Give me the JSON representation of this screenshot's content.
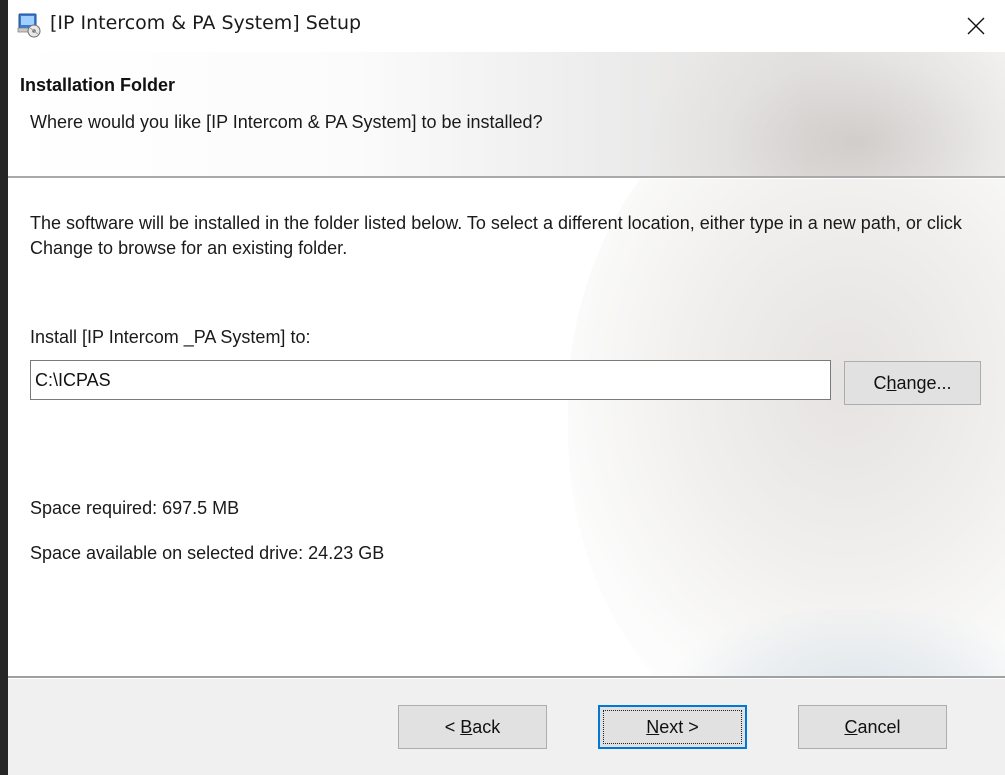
{
  "window": {
    "title": "[IP Intercom & PA System] Setup"
  },
  "header": {
    "title": "Installation Folder",
    "subtitle": "Where would you like [IP Intercom & PA System] to be installed?"
  },
  "content": {
    "description": "The software will be installed in the folder listed below. To select a different location, either type in a new path, or click Change to browse for an existing folder.",
    "install_label": "Install [IP Intercom _PA System] to:",
    "install_path": "C:\\ICPAS",
    "change_button": {
      "before": "C",
      "underline": "h",
      "after": "ange..."
    },
    "space_required": "Space required: 697.5 MB",
    "space_available": "Space available on selected drive: 24.23 GB"
  },
  "footer": {
    "back_button": {
      "before": "< ",
      "underline": "B",
      "after": "ack"
    },
    "next_button": {
      "before": "",
      "underline": "N",
      "after": "ext >"
    },
    "cancel_button": {
      "before": "",
      "underline": "C",
      "after": "ancel"
    }
  },
  "icons": {
    "app_icon": "installer-icon",
    "close_icon": "close-icon"
  },
  "colors": {
    "focus_border": "#0078d7",
    "button_face": "#e1e1e1",
    "footer_bg": "#f0f0f0"
  }
}
